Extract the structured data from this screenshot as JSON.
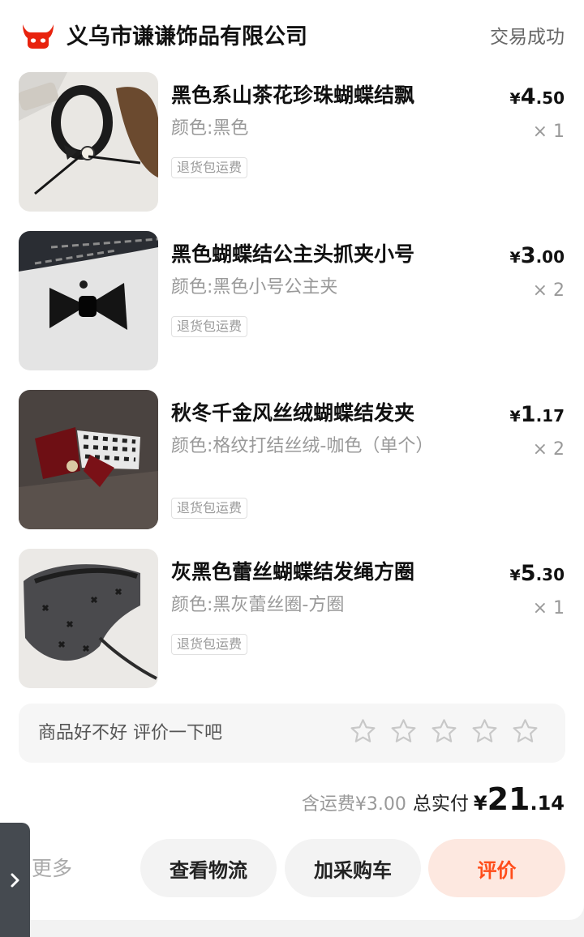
{
  "header": {
    "shop_name": "义乌市谦谦饰品有限公司",
    "status": "交易成功",
    "logo_icon": "tmall-cat-icon",
    "logo_color": "#e8230e"
  },
  "items": [
    {
      "title": "黑色系山茶花珍珠蝴蝶结飘",
      "spec": "颜色:黑色",
      "tag": "退货包运费",
      "price_currency": "¥",
      "price_int": "4",
      "price_dec": ".50",
      "qty": "× 1"
    },
    {
      "title": "黑色蝴蝶结公主头抓夹小号",
      "spec": "颜色:黑色小号公主夹",
      "tag": "退货包运费",
      "price_currency": "¥",
      "price_int": "3",
      "price_dec": ".00",
      "qty": "× 2"
    },
    {
      "title": "秋冬千金风丝绒蝴蝶结发夹",
      "spec": "颜色:格纹打结丝绒-咖色（单个）",
      "tag": "退货包运费",
      "price_currency": "¥",
      "price_int": "1",
      "price_dec": ".17",
      "qty": "× 2"
    },
    {
      "title": "灰黑色蕾丝蝴蝶结发绳方圈",
      "spec": "颜色:黑灰蕾丝圈-方圈",
      "tag": "退货包运费",
      "price_currency": "¥",
      "price_int": "5",
      "price_dec": ".30",
      "qty": "× 1"
    }
  ],
  "rating": {
    "prompt": "商品好不好 评价一下吧",
    "star_icon": "star-outline-icon",
    "star_count": 5
  },
  "totals": {
    "shipping": "含运费¥3.00",
    "label": "总实付",
    "currency": "¥",
    "int": "21",
    "dec": ".14"
  },
  "actions": {
    "more": "更多",
    "logistics": "查看物流",
    "cart": "加采购车",
    "review": "评价",
    "review_color": "#ff4d1a"
  },
  "side_tab_icon": "chevron-right-icon"
}
